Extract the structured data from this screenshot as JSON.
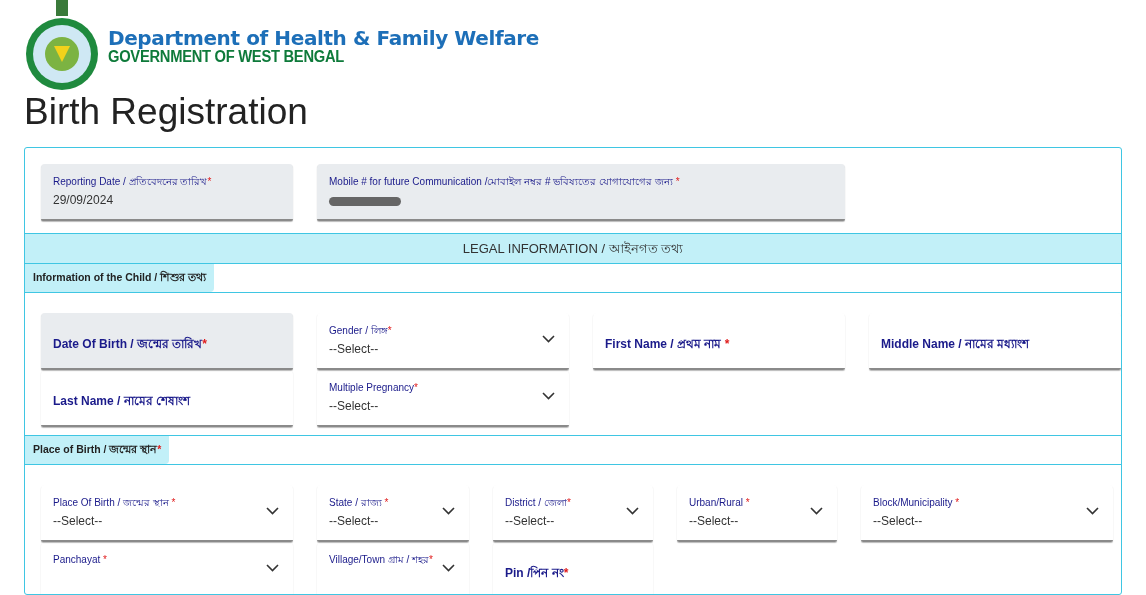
{
  "header": {
    "department": "Department of Health & Family Welfare",
    "government": "GOVERNMENT OF WEST BENGAL"
  },
  "page_title": "Birth Registration",
  "top_fields": [
    {
      "kind": "filled",
      "label": "Reporting Date / প্রতিবেদনের তারিখ",
      "required_mark": "*",
      "value": "29/09/2024"
    },
    {
      "kind": "redacted",
      "label": "Mobile # for future Communication /মোবাইল নম্বর # ভবিষ্যতের যোগাযোগের জন্য ",
      "required_mark": "*"
    }
  ],
  "legal_band": "LEGAL INFORMATION / আইনগত তথ্য",
  "sections": [
    {
      "title": "Information of the Child / শিশুর তথ্য",
      "fields": [
        {
          "kind": "date",
          "label": "Date Of Birth / জন্মের তারিখ",
          "required_mark": "*"
        },
        {
          "kind": "select",
          "label": "Gender / লিঙ্গ",
          "required_mark": "*",
          "value": "--Select--"
        },
        {
          "kind": "text",
          "label": "First Name / প্রথম নাম ",
          "required_mark": "*"
        },
        {
          "kind": "text",
          "label": "Middle Name / নামের মধ্যাংশ"
        },
        {
          "kind": "text",
          "label": "Last Name / নামের শেষাংশ"
        },
        {
          "kind": "select",
          "label": "Multiple Pregnancy",
          "required_mark": "*",
          "value": "--Select--"
        }
      ]
    },
    {
      "title": "Place of Birth / জন্মের স্থান",
      "required_mark": "*",
      "fields": [
        {
          "kind": "select",
          "label": "Place Of Birth / জন্মের স্থান ",
          "required_mark": "*",
          "value": "--Select--"
        },
        {
          "kind": "select",
          "label": "State / রাজ্য ",
          "required_mark": "*",
          "value": "--Select--"
        },
        {
          "kind": "select",
          "label": "District / জেলা",
          "required_mark": "*",
          "value": "--Select--"
        },
        {
          "kind": "select",
          "label": "Urban/Rural ",
          "required_mark": "*",
          "value": "--Select--"
        },
        {
          "kind": "select",
          "label": "Block/Municipality ",
          "required_mark": "*",
          "value": "--Select--"
        },
        {
          "kind": "select",
          "label": "Panchayat ",
          "required_mark": "*"
        },
        {
          "kind": "select",
          "label": "Village/Town গ্রাম / শহর",
          "required_mark": "*"
        },
        {
          "kind": "text",
          "label": "Pin /পিন নং",
          "required_mark": "*"
        }
      ]
    }
  ]
}
